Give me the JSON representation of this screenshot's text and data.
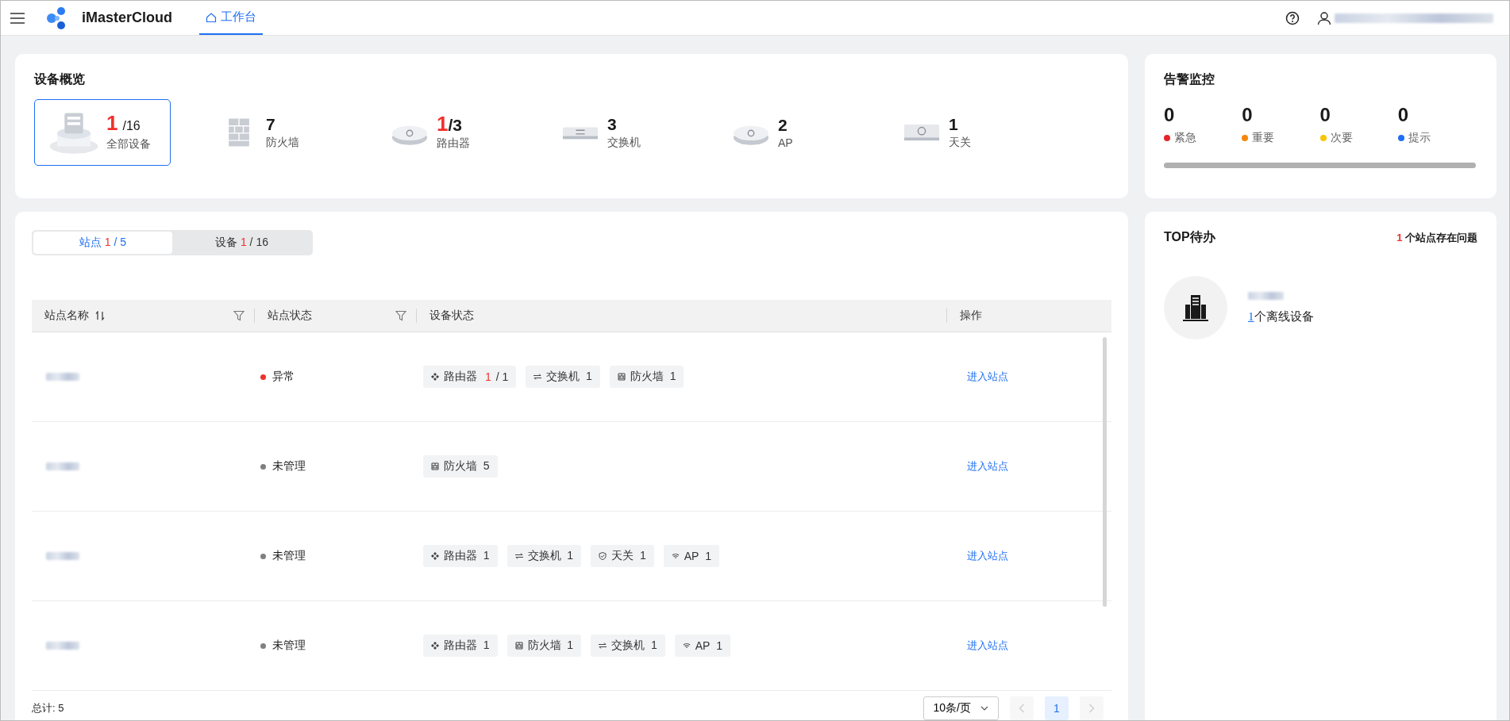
{
  "header": {
    "brand": "iMasterCloud",
    "nav": [
      {
        "label": "工作台",
        "selected": true
      }
    ]
  },
  "overview": {
    "title": "设备概览",
    "items": [
      {
        "kind": "all",
        "fault": "1",
        "total": "/16",
        "label": "全部设备",
        "selected": true
      },
      {
        "kind": "firewall",
        "total": "7",
        "label": "防火墙",
        "selected": false
      },
      {
        "kind": "router",
        "fault": "1",
        "total": "/3",
        "label": "路由器",
        "selected": false
      },
      {
        "kind": "switch",
        "total": "3",
        "label": "交换机",
        "selected": false
      },
      {
        "kind": "ap",
        "total": "2",
        "label": "AP",
        "selected": false
      },
      {
        "kind": "gateway",
        "total": "1",
        "label": "天关",
        "selected": false
      }
    ]
  },
  "alarms": {
    "title": "告警监控",
    "items": [
      {
        "count": "0",
        "label": "紧急",
        "color": "#e5252a"
      },
      {
        "count": "0",
        "label": "重要",
        "color": "#f5860a"
      },
      {
        "count": "0",
        "label": "次要",
        "color": "#f7c600"
      },
      {
        "count": "0",
        "label": "提示",
        "color": "#1f6ff2"
      }
    ]
  },
  "tabs": [
    {
      "label": "站点",
      "fault": "1",
      "total": " / 5",
      "selected": true
    },
    {
      "label": "设备",
      "fault": "1",
      "total": " / 16",
      "selected": false
    }
  ],
  "table": {
    "columns": [
      {
        "label": "站点名称",
        "sortable": true,
        "filterable": true
      },
      {
        "label": "站点状态",
        "sortable": false,
        "filterable": true
      },
      {
        "label": "设备状态",
        "sortable": false,
        "filterable": false
      },
      {
        "label": "操作",
        "sortable": false,
        "filterable": false
      }
    ],
    "rows": [
      {
        "status": {
          "label": "异常",
          "color": "#f0302c"
        },
        "devices": [
          {
            "kind": "router",
            "label": "路由器",
            "fault": "1",
            "total": " / 1"
          },
          {
            "kind": "switch",
            "label": "交换机",
            "total": "1"
          },
          {
            "kind": "firewall",
            "label": "防火墙",
            "total": "1"
          }
        ],
        "action": "进入站点"
      },
      {
        "status": {
          "label": "未管理",
          "color": "#808080"
        },
        "devices": [
          {
            "kind": "firewall",
            "label": "防火墙",
            "total": "5"
          }
        ],
        "action": "进入站点"
      },
      {
        "status": {
          "label": "未管理",
          "color": "#808080"
        },
        "devices": [
          {
            "kind": "router",
            "label": "路由器",
            "total": "1"
          },
          {
            "kind": "switch",
            "label": "交换机",
            "total": "1"
          },
          {
            "kind": "gateway",
            "label": "天关",
            "total": "1"
          },
          {
            "kind": "ap",
            "label": "AP",
            "total": "1"
          }
        ],
        "action": "进入站点"
      },
      {
        "status": {
          "label": "未管理",
          "color": "#808080"
        },
        "devices": [
          {
            "kind": "router",
            "label": "路由器",
            "total": "1"
          },
          {
            "kind": "firewall",
            "label": "防火墙",
            "total": "1"
          },
          {
            "kind": "switch",
            "label": "交换机",
            "total": "1"
          },
          {
            "kind": "ap",
            "label": "AP",
            "total": "1"
          }
        ],
        "action": "进入站点"
      }
    ]
  },
  "footer": {
    "total": "总计: 5",
    "page_size": "10条/页",
    "pages": [
      {
        "label": "1",
        "selected": true
      }
    ]
  },
  "todo": {
    "title": "TOP待办",
    "summary_count": "1",
    "summary_text": "个站点存在问题",
    "items": [
      {
        "count": "1",
        "text": "个离线设备"
      }
    ]
  }
}
